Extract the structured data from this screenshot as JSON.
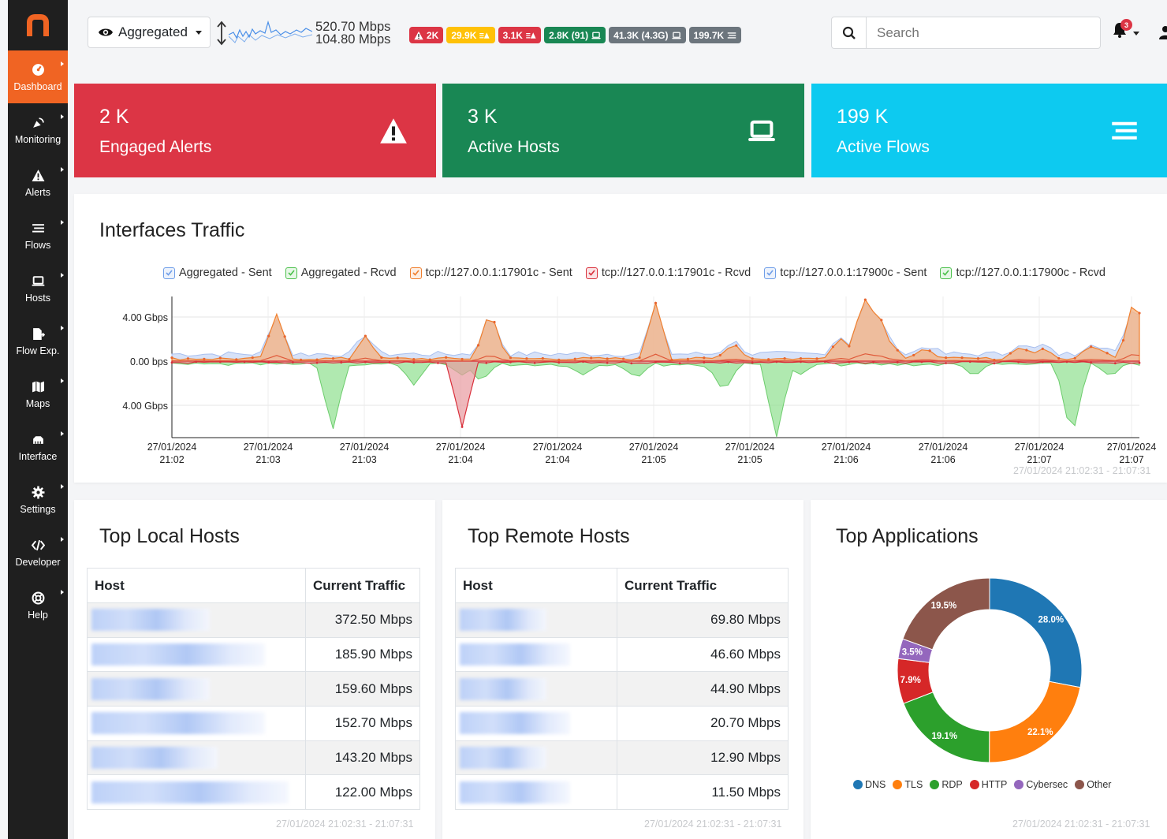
{
  "sidebar": {
    "items": [
      {
        "label": "Dashboard",
        "icon": "dashboard-icon",
        "active": true
      },
      {
        "label": "Monitoring",
        "icon": "satellite-dish-icon"
      },
      {
        "label": "Alerts",
        "icon": "warning-icon"
      },
      {
        "label": "Flows",
        "icon": "flows-icon"
      },
      {
        "label": "Hosts",
        "icon": "laptop-icon"
      },
      {
        "label": "Flow Exp.",
        "icon": "file-export-icon"
      },
      {
        "label": "Maps",
        "icon": "map-icon"
      },
      {
        "label": "Interface",
        "icon": "ethernet-icon"
      },
      {
        "label": "Settings",
        "icon": "gear-icon"
      },
      {
        "label": "Developer",
        "icon": "code-icon"
      },
      {
        "label": "Help",
        "icon": "lifebuoy-icon"
      }
    ]
  },
  "topbar": {
    "interface_label": "Aggregated",
    "rate_up": "520.70 Mbps",
    "rate_down": "104.80 Mbps",
    "badges": [
      {
        "text": "2K",
        "color": "#dc3545",
        "icon": "warning-icon",
        "icon_pos": "before"
      },
      {
        "text": "29.9K",
        "color": "#ffc107",
        "icon": "flows-warning-icon",
        "icon_pos": "after"
      },
      {
        "text": "3.1K",
        "color": "#dc3545",
        "icon": "flows-warning-icon",
        "icon_pos": "after"
      },
      {
        "text": "2.8K (91)",
        "color": "#198754",
        "icon": "laptop-icon",
        "icon_pos": "after"
      },
      {
        "text": "41.3K (4.3G)",
        "color": "#6c757d",
        "icon": "laptop-icon",
        "icon_pos": "after"
      },
      {
        "text": "199.7K",
        "color": "#6c757d",
        "icon": "flows-icon",
        "icon_pos": "after"
      }
    ],
    "search_placeholder": "Search",
    "notification_count": "3"
  },
  "stats": [
    {
      "value": "2 K",
      "label": "Engaged Alerts",
      "color": "#dc3545",
      "icon": "warning-icon"
    },
    {
      "value": "3 K",
      "label": "Active Hosts",
      "color": "#198754",
      "icon": "laptop-icon"
    },
    {
      "value": "199 K",
      "label": "Active Flows",
      "color": "#0dcaf0",
      "icon": "flows-icon"
    }
  ],
  "traffic": {
    "title": "Interfaces Traffic",
    "time_range": "27/01/2024 21:02:31 - 21:07:31"
  },
  "chart_data": {
    "type": "area",
    "legend": [
      {
        "name": "Aggregated - Sent",
        "color": "#6f9ee8"
      },
      {
        "name": "Aggregated - Rcvd",
        "color": "#4cc04c"
      },
      {
        "name": "tcp://127.0.0.1:17901c - Sent",
        "color": "#f07f2e"
      },
      {
        "name": "tcp://127.0.0.1:17901c - Rcvd",
        "color": "#d9303b"
      },
      {
        "name": "tcp://127.0.0.1:17900c - Sent",
        "color": "#6f9ee8"
      },
      {
        "name": "tcp://127.0.0.1:17900c - Rcvd",
        "color": "#4cc04c"
      }
    ],
    "y_ticks": [
      "4.00 Gbps",
      "0.00 bps",
      "4.00 Gbps"
    ],
    "x_ticks": [
      [
        "27/01/2024",
        "21:02"
      ],
      [
        "27/01/2024",
        "21:03"
      ],
      [
        "27/01/2024",
        "21:03"
      ],
      [
        "27/01/2024",
        "21:04"
      ],
      [
        "27/01/2024",
        "21:04"
      ],
      [
        "27/01/2024",
        "21:05"
      ],
      [
        "27/01/2024",
        "21:05"
      ],
      [
        "27/01/2024",
        "21:06"
      ],
      [
        "27/01/2024",
        "21:06"
      ],
      [
        "27/01/2024",
        "21:07"
      ],
      [
        "27/01/2024",
        "21:07"
      ]
    ],
    "ylim_gbps": [
      -7,
      6
    ],
    "sent_spikes_gbps": [
      {
        "t": 0.108,
        "v": 4.0
      },
      {
        "t": 0.2,
        "v": 2.1
      },
      {
        "t": 0.329,
        "v": 4.6
      },
      {
        "t": 0.5,
        "v": 5.1
      },
      {
        "t": 0.58,
        "v": 1.5
      },
      {
        "t": 0.69,
        "v": 2.0
      },
      {
        "t": 0.704,
        "v": 1.5
      },
      {
        "t": 0.741,
        "v": 1.7
      },
      {
        "t": 0.877,
        "v": 1.2
      },
      {
        "t": 0.899,
        "v": 1.0
      },
      {
        "t": 0.78,
        "v": 1.0
      },
      {
        "t": 0.95,
        "v": 1.2
      },
      {
        "t": 0.96,
        "v": 1.0
      },
      {
        "t": 0.985,
        "v": 0.4
      },
      {
        "t": 0.995,
        "v": 5.9
      },
      {
        "t": 0.715,
        "v": 5.9
      },
      {
        "t": 0.728,
        "v": 5.3
      }
    ],
    "rcvd_spikes_gbps": [
      {
        "t": 0.166,
        "v": -6.0
      },
      {
        "t": 0.25,
        "v": -2.0
      },
      {
        "t": 0.3,
        "v": -1.0
      },
      {
        "t": 0.32,
        "v": -1.5
      },
      {
        "t": 0.57,
        "v": -2.5
      },
      {
        "t": 0.424,
        "v": -1.0
      },
      {
        "t": 0.48,
        "v": -1.2
      },
      {
        "t": 0.563,
        "v": -0.5
      },
      {
        "t": 0.625,
        "v": -6.5
      },
      {
        "t": 0.65,
        "v": -1.0
      },
      {
        "t": 0.83,
        "v": -1.0
      },
      {
        "t": 0.93,
        "v": -6.9
      },
      {
        "t": 0.97,
        "v": -1.2
      }
    ],
    "red_dip": {
      "t": 0.3,
      "v": -5.8
    }
  },
  "local_hosts": {
    "title": "Top Local Hosts",
    "col_host": "Host",
    "col_traffic": "Current Traffic",
    "rows": [
      "372.50 Mbps",
      "185.90 Mbps",
      "159.60 Mbps",
      "152.70 Mbps",
      "143.20 Mbps",
      "122.00 Mbps"
    ],
    "time_range": "27/01/2024 21:02:31 - 21:07:31"
  },
  "remote_hosts": {
    "title": "Top Remote Hosts",
    "col_host": "Host",
    "col_traffic": "Current Traffic",
    "rows": [
      "69.80 Mbps",
      "46.60 Mbps",
      "44.90 Mbps",
      "20.70 Mbps",
      "12.90 Mbps",
      "11.50 Mbps"
    ],
    "time_range": "27/01/2024 21:02:31 - 21:07:31"
  },
  "apps": {
    "title": "Top Applications",
    "time_range": "27/01/2024 21:02:31 - 21:07:31",
    "chart_data": {
      "type": "pie",
      "slices": [
        {
          "name": "DNS",
          "value": 28.0,
          "label": "28.0%",
          "color": "#1f77b4"
        },
        {
          "name": "TLS",
          "value": 22.1,
          "label": "22.1%",
          "color": "#ff7f0e"
        },
        {
          "name": "RDP",
          "value": 19.1,
          "label": "19.1%",
          "color": "#2ca02c"
        },
        {
          "name": "HTTP",
          "value": 7.9,
          "label": "7.9%",
          "color": "#d62728"
        },
        {
          "name": "Cybersec",
          "value": 3.5,
          "label": "3.5%",
          "color": "#9467bd"
        },
        {
          "name": "Other",
          "value": 19.5,
          "label": "19.5%",
          "color": "#8c564b"
        }
      ]
    }
  }
}
